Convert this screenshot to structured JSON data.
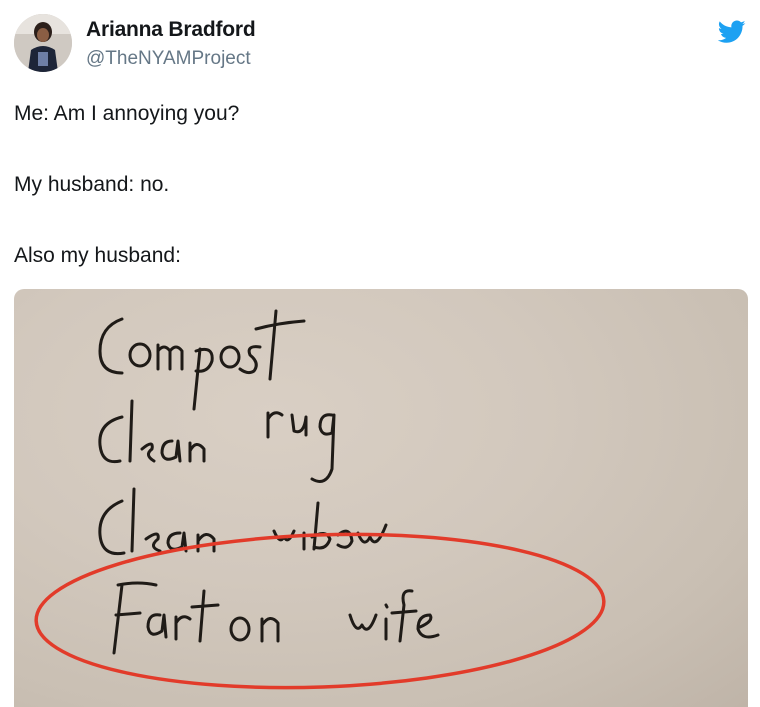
{
  "tweet": {
    "author_name": "Arianna Bradford",
    "author_handle": "@TheNYAMProject",
    "lines": [
      "Me: Am I annoying you?",
      "My husband: no.",
      "Also my husband:"
    ],
    "icons": {
      "platform": "twitter-bird-icon",
      "avatar": "avatar"
    },
    "brand_color": "#1da1f2"
  },
  "photo": {
    "note_lines": [
      "Compost",
      "Clean rug",
      "Clean window",
      "Fart on wife"
    ],
    "ink_color": "#1f1b17",
    "circle_color": "#e23b2a"
  }
}
